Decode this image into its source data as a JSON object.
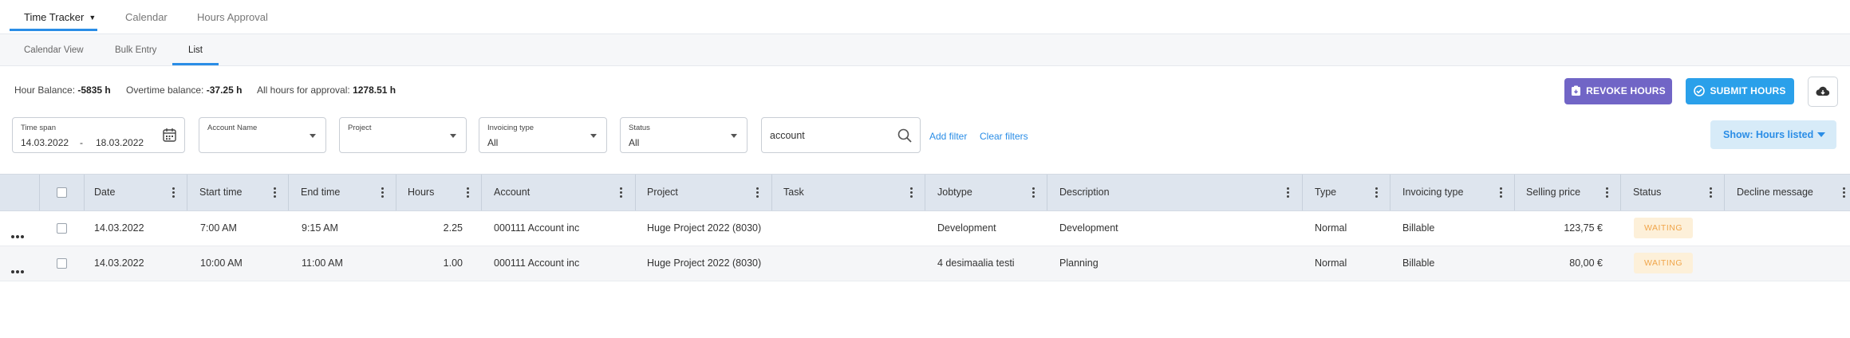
{
  "top_tabs": [
    {
      "label": "Time Tracker",
      "active": true
    },
    {
      "label": "Calendar",
      "active": false
    },
    {
      "label": "Hours Approval",
      "active": false
    }
  ],
  "sub_tabs": [
    {
      "label": "Calendar View",
      "active": false
    },
    {
      "label": "Bulk Entry",
      "active": false
    },
    {
      "label": "List",
      "active": true
    }
  ],
  "balance": {
    "hour_label": "Hour Balance:",
    "hour_value": "-5835 h",
    "overtime_label": "Overtime balance:",
    "overtime_value": "-37.25 h",
    "approval_label": "All hours for approval:",
    "approval_value": "1278.51 h"
  },
  "actions": {
    "revoke_label": "REVOKE HOURS",
    "submit_label": "SUBMIT HOURS",
    "revoke_color": "#7165c6",
    "submit_color": "#2aa0ea"
  },
  "filters": {
    "timespan_label": "Time span",
    "timespan_start": "14.03.2022",
    "timespan_sep": "-",
    "timespan_end": "18.03.2022",
    "account_label": "Account Name",
    "project_label": "Project",
    "invoicing_label": "Invoicing type",
    "invoicing_value": "All",
    "status_label": "Status",
    "status_value": "All",
    "search_value": "account",
    "add_filter": "Add filter",
    "clear_filters": "Clear filters",
    "show_label": "Show: Hours listed"
  },
  "table": {
    "columns": [
      "Date",
      "Start time",
      "End time",
      "Hours",
      "Account",
      "Project",
      "Task",
      "Jobtype",
      "Description",
      "Type",
      "Invoicing type",
      "Selling price",
      "Status",
      "Decline message"
    ],
    "rows": [
      {
        "date": "14.03.2022",
        "start": "7:00 AM",
        "end": "9:15 AM",
        "hours": "2.25",
        "account": "000111 Account inc",
        "project": "Huge Project 2022 (8030)",
        "task": "",
        "jobtype": "Development",
        "description": "Development",
        "type": "Normal",
        "invoicing": "Billable",
        "price": "123,75 €",
        "status": "WAITING",
        "decline": ""
      },
      {
        "date": "14.03.2022",
        "start": "10:00 AM",
        "end": "11:00 AM",
        "hours": "1.00",
        "account": "000111 Account inc",
        "project": "Huge Project 2022 (8030)",
        "task": "",
        "jobtype": "4 desimaalia testi",
        "description": "Planning",
        "type": "Normal",
        "invoicing": "Billable",
        "price": "80,00 €",
        "status": "WAITING",
        "decline": ""
      }
    ]
  },
  "icons": {
    "revoke": "revoke-icon",
    "submit": "check-circle-icon",
    "download": "cloud-download-icon",
    "calendar": "calendar-icon",
    "search": "search-icon"
  }
}
